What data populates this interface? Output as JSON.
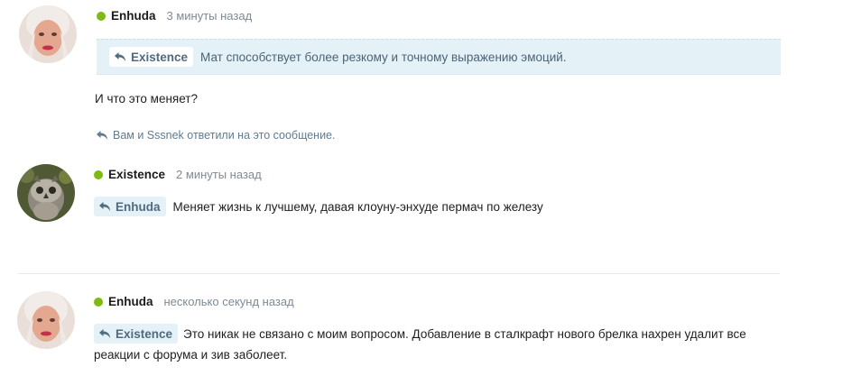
{
  "colors": {
    "online": "#7dba12",
    "quote_bg": "#e4f1f7",
    "chip_text": "#506a7e",
    "meta_text": "#7d8a97"
  },
  "posts": [
    {
      "author": "Enhuda",
      "time": "3 минуты назад",
      "avatar_icon": "woman-avatar-icon",
      "quote": {
        "author": "Existence",
        "text": "Мат способствует более резкому и точному выражению эмоций."
      },
      "body": "И что это меняет?",
      "replied_by": "Вам и Sssnek ответили на это сообщение."
    },
    {
      "author": "Existence",
      "time": "2 минуты назад",
      "avatar_icon": "owl-avatar-icon",
      "reply_to": "Enhuda",
      "body": "Меняет жизнь к лучшему, давая клоуну-энхуде пермач по железу"
    },
    {
      "author": "Enhuda",
      "time": "несколько секунд назад",
      "avatar_icon": "woman-avatar-icon",
      "reply_to": "Existence",
      "body": "Это никак не связано с моим вопросом. Добавление в сталкрафт нового брелка нахрен удалит все реакции с форума и зив заболеет."
    }
  ]
}
